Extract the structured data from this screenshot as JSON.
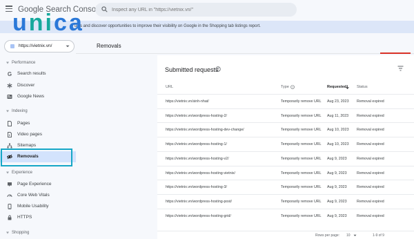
{
  "topbar": {
    "logo_google": "Google",
    "logo_product": "Search Console",
    "search_placeholder": "Inspect any URL in \"https://vietnix.vn/\""
  },
  "overlay_logo": {
    "text_a": "u",
    "text_ni": "ni",
    "text_ca": "ca"
  },
  "banner": {
    "text": "ucts and discover opportunities to improve their visibility on Google in the Shopping tab listings report."
  },
  "property": {
    "label": "https://vietnix.vn/"
  },
  "sidebar": {
    "sections": [
      {
        "title": "Performance"
      },
      {
        "title": "Indexing"
      },
      {
        "title": "Experience"
      },
      {
        "title": "Shopping"
      }
    ],
    "items": [
      {
        "label": "Search results"
      },
      {
        "label": "Discover"
      },
      {
        "label": "Google News"
      },
      {
        "label": "Pages"
      },
      {
        "label": "Video pages"
      },
      {
        "label": "Sitemaps"
      },
      {
        "label": "Removals"
      },
      {
        "label": "Page Experience"
      },
      {
        "label": "Core Web Vitals"
      },
      {
        "label": "Mobile Usability"
      },
      {
        "label": "HTTPS"
      }
    ]
  },
  "main": {
    "title": "Removals"
  },
  "card": {
    "title": "Submitted requests",
    "columns": {
      "url": "URL",
      "type": "Type",
      "requested": "Requested",
      "status": "Status"
    },
    "rows": [
      {
        "url": "https://vietnix.vn/sinh-nhat/",
        "type": "Temporarily remove URL",
        "requested": "Aug 23, 2023",
        "status": "Removal expired"
      },
      {
        "url": "https://vietnix.vn/wordpress-hosting-2/",
        "type": "Temporarily remove URL",
        "requested": "Aug 11, 2023",
        "status": "Removal expired"
      },
      {
        "url": "https://vietnix.vn/wordpress-hosting-dev-change/",
        "type": "Temporarily remove URL",
        "requested": "Aug 10, 2023",
        "status": "Removal expired"
      },
      {
        "url": "https://vietnix.vn/wordpress-hosting-1/",
        "type": "Temporarily remove URL",
        "requested": "Aug 10, 2023",
        "status": "Removal expired"
      },
      {
        "url": "https://vietnix.vn/wordpress-hosting-v2/",
        "type": "Temporarily remove URL",
        "requested": "Aug 9, 2023",
        "status": "Removal expired"
      },
      {
        "url": "https://vietnix.vn/wordpress-hosting-vietnix/",
        "type": "Temporarily remove URL",
        "requested": "Aug 9, 2023",
        "status": "Removal expired"
      },
      {
        "url": "https://vietnix.vn/wordpress-hosting-3/",
        "type": "Temporarily remove URL",
        "requested": "Aug 9, 2023",
        "status": "Removal expired"
      },
      {
        "url": "https://vietnix.vn/wordpress-hosting-post/",
        "type": "Temporarily remove URL",
        "requested": "Aug 9, 2023",
        "status": "Removal expired"
      },
      {
        "url": "https://vietnix.vn/wordpress-hosting-grid/",
        "type": "Temporarily remove URL",
        "requested": "Aug 9, 2023",
        "status": "Removal expired"
      }
    ],
    "footer": {
      "rows_label": "Rows per page:",
      "rows_value": "10",
      "range": "1-9 of 9"
    }
  }
}
